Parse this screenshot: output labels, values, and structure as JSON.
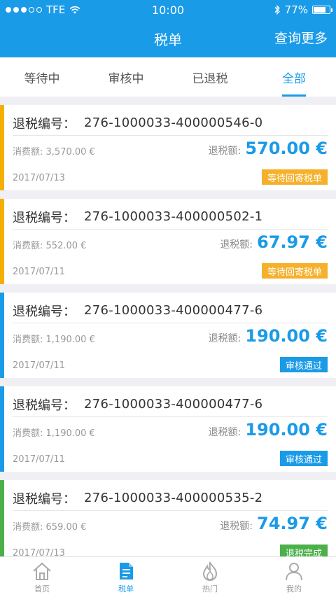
{
  "statusbar": {
    "carrier": "TFE",
    "time": "10:00",
    "battery_text": "77%",
    "battery_level": 0.77
  },
  "nav": {
    "title": "税单",
    "action": "查询更多"
  },
  "tabs": [
    {
      "label": "等待中",
      "active": false
    },
    {
      "label": "审核中",
      "active": false
    },
    {
      "label": "已退税",
      "active": false
    },
    {
      "label": "全部",
      "active": true
    }
  ],
  "labels": {
    "ref_prefix": "退税编号：",
    "spend_prefix": "消费额:",
    "refund_prefix": "退税额:"
  },
  "records": [
    {
      "ref_no": "276-1000033-400000546-0",
      "spend": "3,570.00 €",
      "refund": "570.00 €",
      "date": "2017/07/13",
      "status": "等待回寄税单",
      "status_color": "#f5b12c"
    },
    {
      "ref_no": "276-1000033-400000502-1",
      "spend": "552.00 €",
      "refund": "67.97 €",
      "date": "2017/07/11",
      "status": "等待回寄税单",
      "status_color": "#f5b12c"
    },
    {
      "ref_no": "276-1000033-400000477-6",
      "spend": "1,190.00 €",
      "refund": "190.00 €",
      "date": "2017/07/11",
      "status": "审核通过",
      "status_color": "#1a9be8"
    },
    {
      "ref_no": "276-1000033-400000477-6",
      "spend": "1,190.00 €",
      "refund": "190.00 €",
      "date": "2017/07/11",
      "status": "审核通过",
      "status_color": "#1a9be8"
    },
    {
      "ref_no": "276-1000033-400000535-2",
      "spend": "659.00 €",
      "refund": "74.97 €",
      "date": "2017/07/13",
      "status": "退税完成",
      "status_color": "#4bb04a"
    }
  ],
  "tabbar": [
    {
      "label": "首页",
      "icon": "home-icon",
      "active": false
    },
    {
      "label": "税单",
      "icon": "receipt-icon",
      "active": true
    },
    {
      "label": "热门",
      "icon": "flame-icon",
      "active": false
    },
    {
      "label": "我的",
      "icon": "user-icon",
      "active": false
    }
  ],
  "colors": {
    "primary": "#1a9be8",
    "pending": "#f5b12c",
    "approved": "#1a9be8",
    "completed": "#4bb04a"
  }
}
